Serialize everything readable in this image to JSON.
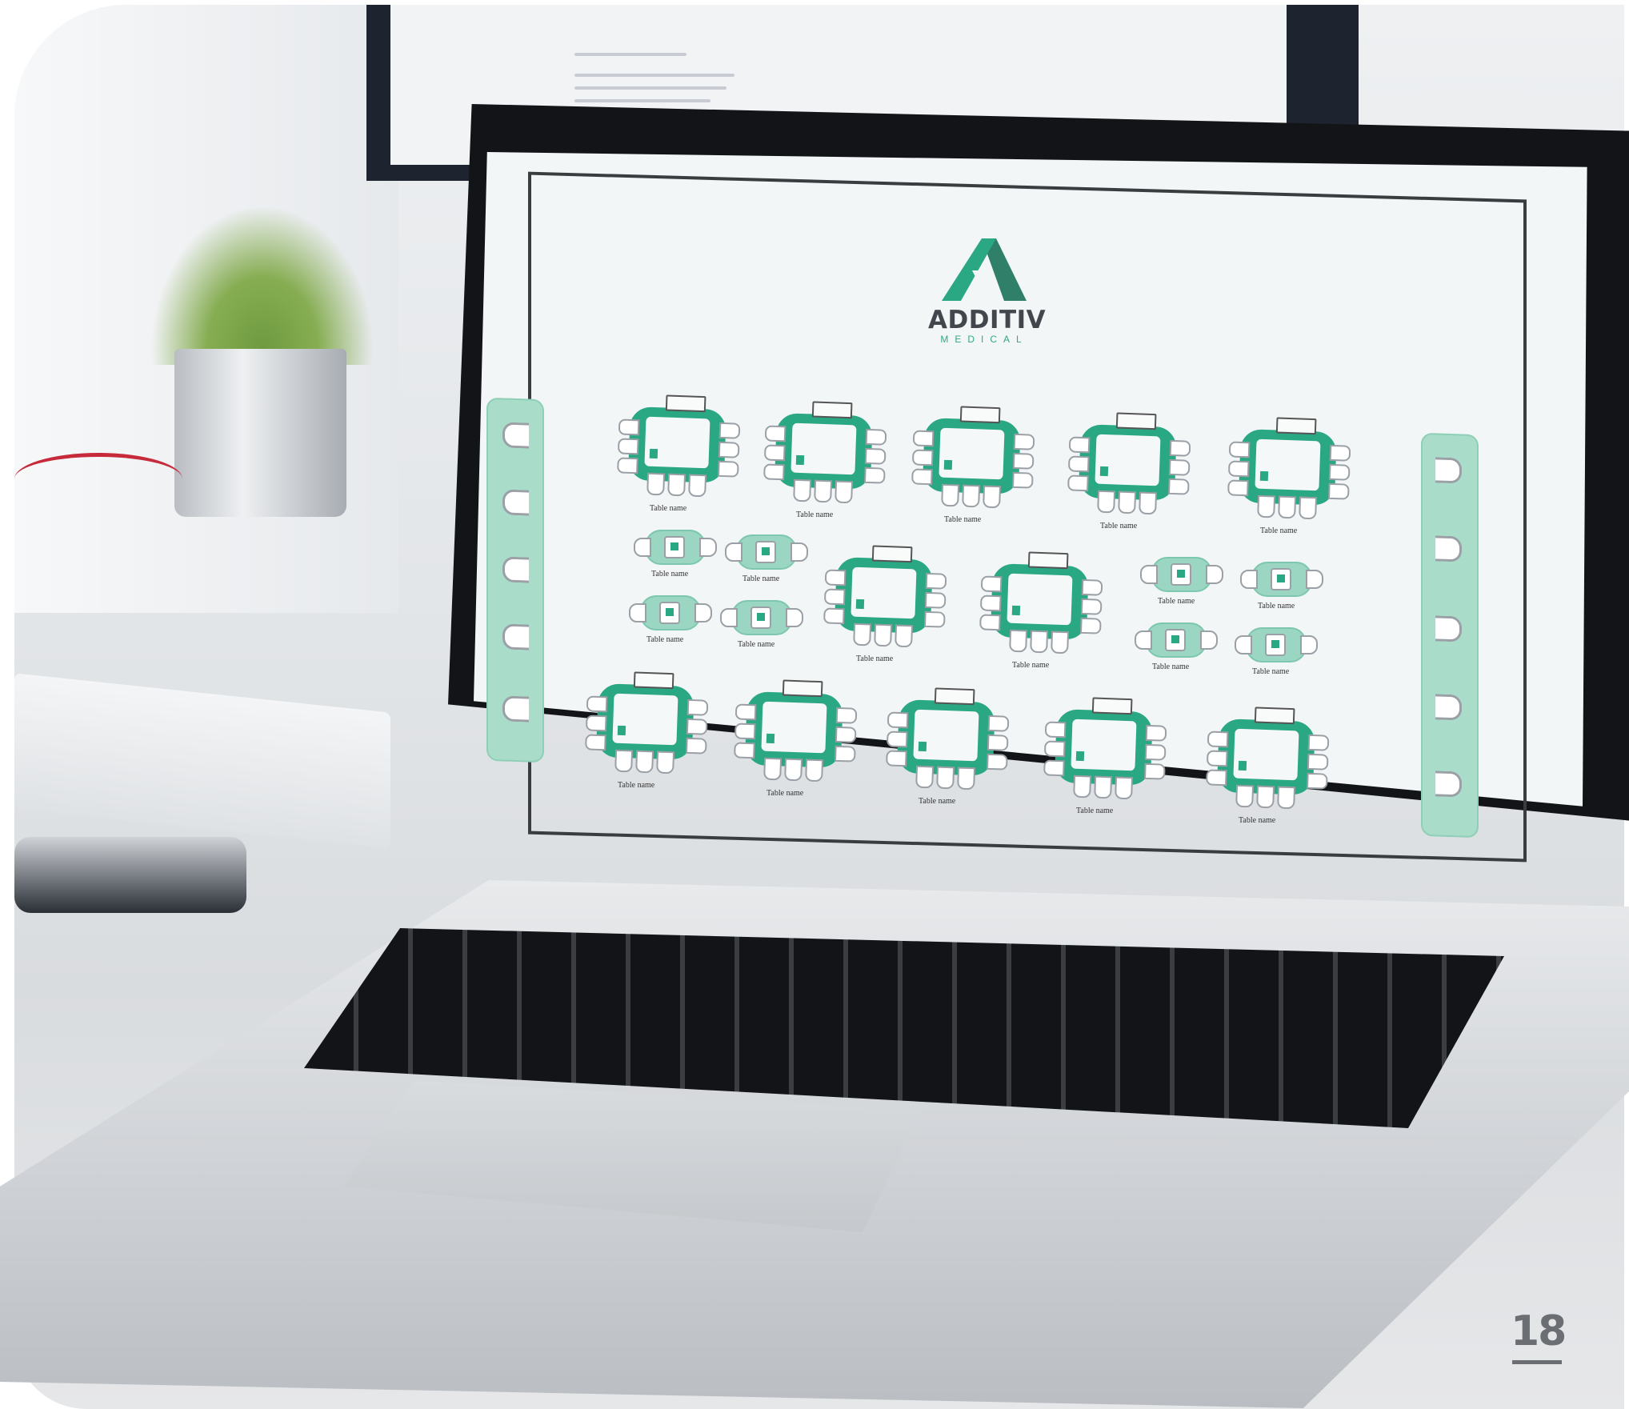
{
  "logo": {
    "name": "ADDITIV",
    "subtitle": "MEDICAL",
    "color": "#2aa783"
  },
  "floor_plan": {
    "table_label": "Table name",
    "rows": [
      {
        "type": "large",
        "count": 5
      },
      {
        "type": "mixed",
        "large": 2,
        "small": 8
      },
      {
        "type": "large",
        "count": 5
      }
    ],
    "left_rail_seats": 5,
    "right_rail_seats": 5,
    "accent_color": "#2aa783",
    "light_accent_color": "#a9dcc9"
  },
  "page": {
    "number": "18"
  }
}
